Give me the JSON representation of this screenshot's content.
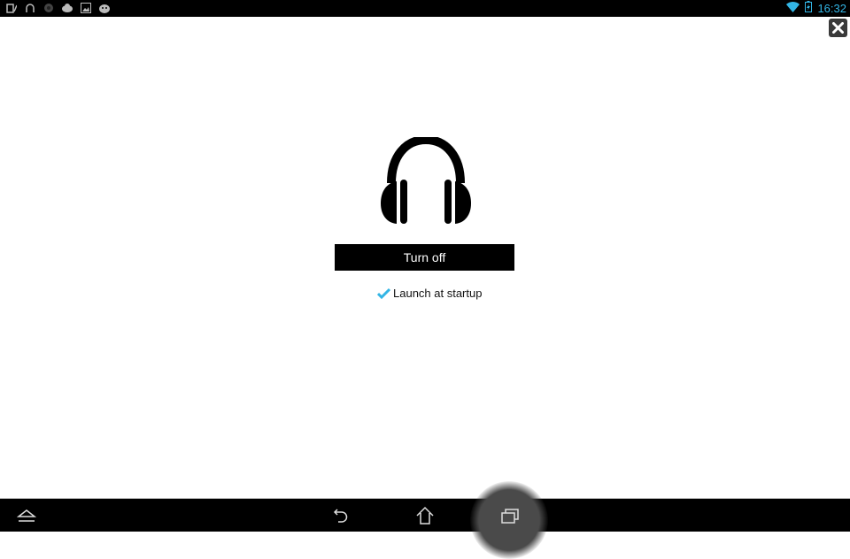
{
  "status_bar": {
    "notification_icons": [
      "clipboard-edit-icon",
      "headphones-icon",
      "media-icon",
      "cloud-sync-icon",
      "image-icon",
      "android-icon"
    ],
    "wifi": "wifi-icon",
    "battery": "battery-charging-icon",
    "time": "16:32",
    "accent_color": "#33b5e5"
  },
  "dialog": {
    "close_icon": "close-icon",
    "main_icon": "headphones-icon",
    "turn_off_label": "Turn off",
    "launch_at_startup": {
      "label": "Launch at startup",
      "checked": true
    }
  },
  "nav_bar": {
    "items": [
      "collapse-icon",
      "back-icon",
      "home-icon",
      "recent-apps-icon"
    ]
  }
}
